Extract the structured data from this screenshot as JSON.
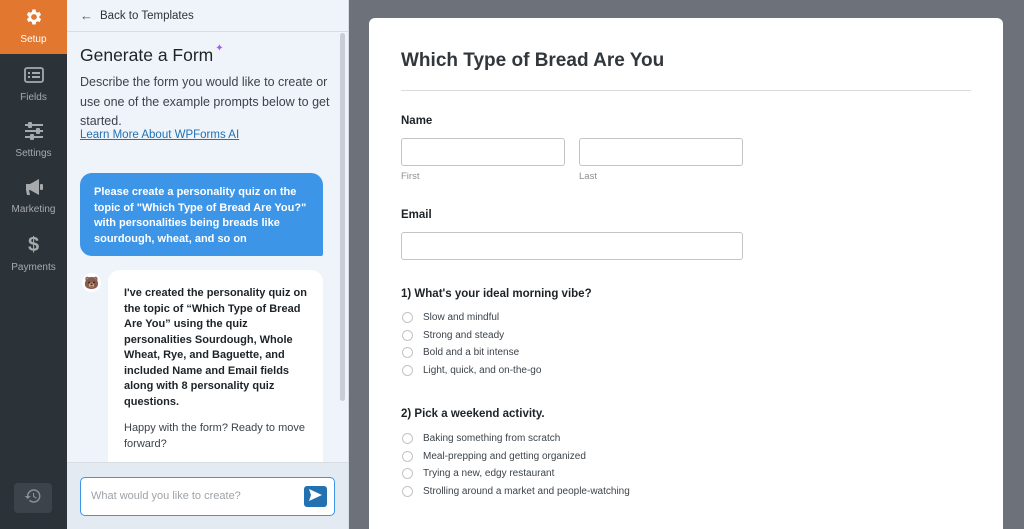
{
  "nav": {
    "items": [
      {
        "label": "Setup",
        "icon": "gear-icon"
      },
      {
        "label": "Fields",
        "icon": "fields-icon"
      },
      {
        "label": "Settings",
        "icon": "sliders-icon"
      },
      {
        "label": "Marketing",
        "icon": "megaphone-icon"
      },
      {
        "label": "Payments",
        "icon": "dollar-icon"
      }
    ],
    "history_icon": "history-icon"
  },
  "panel": {
    "back_label": "Back to Templates",
    "title": "Generate a Form",
    "description": "Describe the form you would like to create or use one of the example prompts below to get started.",
    "learn_more": "Learn More About WPForms AI",
    "user_message": "Please create a personality quiz on the topic of \"Which Type of Bread Are You?\" with personalities being breads like sourdough, wheat, and so on",
    "ai_message": "I've created the personality quiz on the topic of “Which Type of Bread Are You” using the quiz personalities Sourdough, Whole Wheat, Rye, and Baguette, and included Name and Email fields along with 8 personality quiz questions.",
    "ai_followup": "Happy with the form? Ready to move forward?",
    "input_placeholder": "What would you like to create?"
  },
  "form": {
    "title": "Which Type of Bread Are You",
    "name_label": "Name",
    "first_sub": "First",
    "last_sub": "Last",
    "email_label": "Email",
    "questions": [
      {
        "label": "1) What's your ideal morning vibe?",
        "options": [
          "Slow and mindful",
          "Strong and steady",
          "Bold and a bit intense",
          "Light, quick, and on-the-go"
        ]
      },
      {
        "label": "2) Pick a weekend activity.",
        "options": [
          "Baking something from scratch",
          "Meal-prepping and getting organized",
          "Trying a new, edgy restaurant",
          "Strolling around a market and people-watching"
        ]
      }
    ]
  },
  "colors": {
    "accent": "#e27730",
    "nav_bg": "#2c3338",
    "user_bubble": "#3d95e8",
    "link": "#2271b1"
  }
}
